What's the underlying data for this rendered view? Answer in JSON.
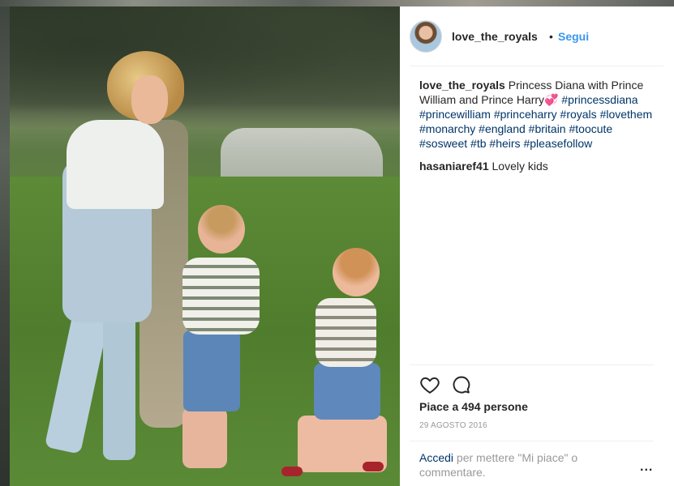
{
  "post": {
    "username": "love_the_royals",
    "dot": "•",
    "follow_label": "Segui",
    "caption_user": "love_the_royals",
    "caption_text": "Princess Diana with Prince William and Prince Harry",
    "caption_emoji": "💞",
    "hashtags": [
      "#princessdiana",
      "#princewilliam",
      "#princeharry",
      "#royals",
      "#lovethem",
      "#monarchy",
      "#england",
      "#britain",
      "#toocute",
      "#sosweet",
      "#tb",
      "#heirs",
      "#pleasefollow"
    ],
    "comment_user": "hasaniaref41",
    "comment_text": "Lovely kids",
    "likes_label": "Piace a 494 persone",
    "date": "29 AGOSTO 2016",
    "login_link": "Accedi",
    "login_text": " per mettere \"Mi piace\" o commentare.",
    "more_label": "..."
  },
  "icons": [
    "heart-icon",
    "comment-icon",
    "more-options-icon"
  ],
  "colors": {
    "link": "#3897f0",
    "hashtag": "#003569",
    "muted": "#999999",
    "text": "#262626"
  }
}
